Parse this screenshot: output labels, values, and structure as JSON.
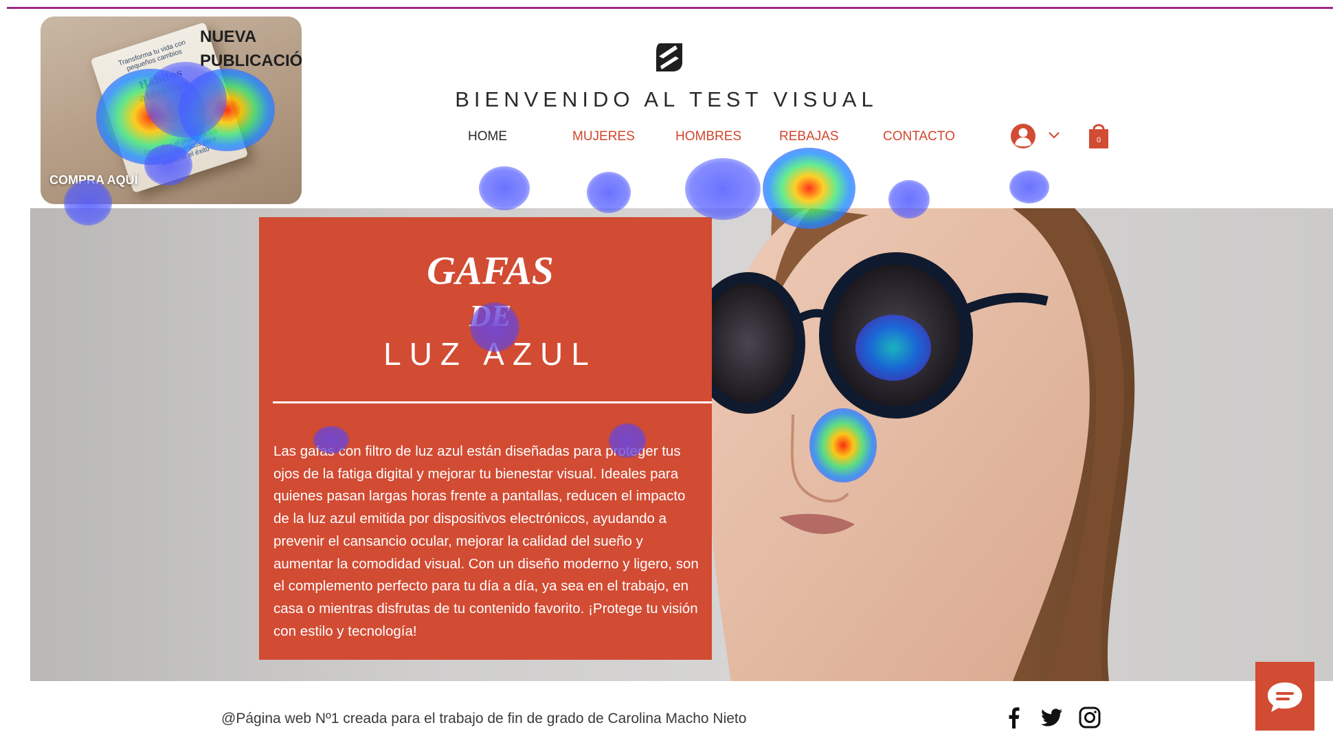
{
  "colors": {
    "accent": "#d24b33",
    "top_line": "#9c2a86",
    "text_dark": "#2a2a2a"
  },
  "promo": {
    "heading_line1": "NUEVA",
    "heading_line2": "PUBLICACIÓN",
    "cta": "COMPRA AQUÍ",
    "book_title": "Hábitos atómicos",
    "book_subtitle": "Transforma tu vida con pequeños cambios",
    "book_tagline": "Descubre el poder de los Hábitos Atómicos para alcanzar el éxito"
  },
  "header": {
    "logo_icon": "s-logo-icon",
    "title": "BIENVENIDO AL TEST VISUAL",
    "nav": [
      "HOME",
      "MUJERES",
      "HOMBRES",
      "REBAJAS",
      "CONTACTO"
    ],
    "account_icon": "user-avatar-icon",
    "cart_icon": "shopping-bag-icon",
    "cart_count": "0"
  },
  "hero": {
    "heading1": "GAFAS",
    "heading2": "DE",
    "heading3": "LUZ AZUL",
    "body": "Las gafas con filtro de luz azul están diseñadas para proteger tus ojos de la fatiga digital y mejorar tu bienestar visual. Ideales para quienes pasan largas horas frente a pantallas, reducen el impacto de la luz azul emitida por dispositivos electrónicos, ayudando a prevenir el cansancio ocular, mejorar la calidad del sueño y aumentar la comodidad visual. Con un diseño moderno y ligero, son el complemento perfecto para tu día a día, ya sea en el trabajo, en casa o mientras disfrutas de tu contenido favorito. ¡Protege tu visión con estilo y tecnología!"
  },
  "footer": {
    "text": "@Página web Nº1 creada para el trabajo de fin de grado de Carolina Macho Nieto",
    "social_icons": [
      "facebook-icon",
      "twitter-icon",
      "instagram-icon"
    ],
    "chat_icon": "chat-bubble-icon"
  }
}
